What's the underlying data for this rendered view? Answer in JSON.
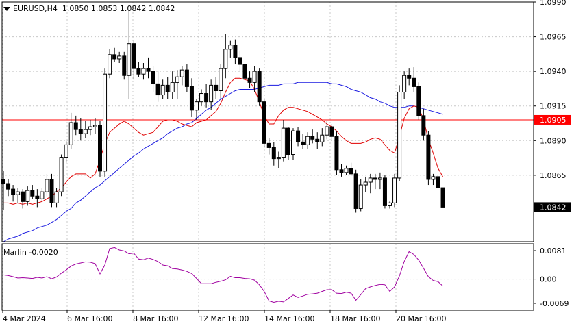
{
  "header": {
    "symbol": "EURUSD,H4",
    "ohlc": "1.0850 1.0853 1.0842 1.0842",
    "arrow_icon": "triangle-down-icon"
  },
  "indicator": {
    "label": "Marlin -0.0020",
    "ticks": [
      "0.0081",
      "0.00",
      "-0.0069"
    ]
  },
  "colors": {
    "ma_fast": "#e00000",
    "ma_slow": "#1a1ae0",
    "oscillator": "#a000a0",
    "level_line": "#ff0000",
    "level_box": "#ff0000",
    "price_box": "#000000",
    "grid": "#c8c8c8",
    "frame": "#000000"
  },
  "chart_data": {
    "type": "candlestick",
    "price_axis": {
      "ticks": [
        "1.0990",
        "1.0965",
        "1.0940",
        "1.0915",
        "1.0890",
        "1.0865",
        "1.0842"
      ],
      "range": [
        1.0817,
        1.099
      ]
    },
    "time_axis": {
      "labels": [
        "4 Mar 2024",
        "6 Mar 16:00",
        "8 Mar 16:00",
        "12 Mar 16:00",
        "14 Mar 16:00",
        "18 Mar 16:00",
        "20 Mar 16:00"
      ]
    },
    "horizontal_level": {
      "value": 1.0905,
      "label": "1.0905"
    },
    "current_price": {
      "value": 1.0842,
      "label": "1.0842"
    },
    "candles": [
      [
        1.0862,
        1.0868,
        1.084,
        1.0859
      ],
      [
        1.0859,
        1.0862,
        1.085,
        1.0855
      ],
      [
        1.0855,
        1.0858,
        1.0846,
        1.0851
      ],
      [
        1.0851,
        1.0856,
        1.0845,
        1.0853
      ],
      [
        1.0853,
        1.0855,
        1.0841,
        1.0846
      ],
      [
        1.0846,
        1.0857,
        1.0843,
        1.0854
      ],
      [
        1.0854,
        1.0858,
        1.0848,
        1.085
      ],
      [
        1.085,
        1.0855,
        1.0842,
        1.0848
      ],
      [
        1.0848,
        1.0856,
        1.0846,
        1.0853
      ],
      [
        1.0853,
        1.0866,
        1.085,
        1.0862
      ],
      [
        1.0862,
        1.0866,
        1.0842,
        1.0845
      ],
      [
        1.0845,
        1.0856,
        1.0842,
        1.0853
      ],
      [
        1.0853,
        1.088,
        1.085,
        1.0878
      ],
      [
        1.0878,
        1.089,
        1.0874,
        1.0887
      ],
      [
        1.0887,
        1.091,
        1.0884,
        1.0903
      ],
      [
        1.0903,
        1.0908,
        1.0894,
        1.0898
      ],
      [
        1.0898,
        1.0906,
        1.089,
        1.0895
      ],
      [
        1.0895,
        1.0904,
        1.0892,
        1.0898
      ],
      [
        1.0898,
        1.0905,
        1.0894,
        1.09
      ],
      [
        1.09,
        1.0906,
        1.0895,
        1.0901
      ],
      [
        1.0901,
        1.0904,
        1.0864,
        1.0868
      ],
      [
        1.0868,
        1.0942,
        1.0864,
        1.0938
      ],
      [
        1.0938,
        1.0956,
        1.0935,
        1.0952
      ],
      [
        1.0952,
        1.0957,
        1.0947,
        1.0949
      ],
      [
        1.0949,
        1.0954,
        1.0946,
        1.0951
      ],
      [
        1.0951,
        1.0954,
        1.0934,
        1.0937
      ],
      [
        1.0937,
        1.0984,
        1.092,
        1.096
      ],
      [
        1.096,
        1.0962,
        1.0934,
        1.0942
      ],
      [
        1.0942,
        1.0947,
        1.0936,
        1.0938
      ],
      [
        1.0938,
        1.0946,
        1.0934,
        1.0942
      ],
      [
        1.0942,
        1.095,
        1.0935,
        1.094
      ],
      [
        1.094,
        1.0944,
        1.0925,
        1.0931
      ],
      [
        1.0931,
        1.094,
        1.0918,
        1.0923
      ],
      [
        1.0923,
        1.0934,
        1.092,
        1.093
      ],
      [
        1.093,
        1.0936,
        1.092,
        1.0925
      ],
      [
        1.0925,
        1.094,
        1.092,
        1.0932
      ],
      [
        1.0932,
        1.0941,
        1.092,
        1.0936
      ],
      [
        1.0936,
        1.0944,
        1.093,
        1.0941
      ],
      [
        1.0941,
        1.0945,
        1.0925,
        1.0929
      ],
      [
        1.0929,
        1.0935,
        1.0907,
        1.0912
      ],
      [
        1.0912,
        1.092,
        1.0905,
        1.0918
      ],
      [
        1.0918,
        1.0927,
        1.0915,
        1.0924
      ],
      [
        1.0924,
        1.0931,
        1.0914,
        1.0918
      ],
      [
        1.0918,
        1.0934,
        1.0912,
        1.093
      ],
      [
        1.093,
        1.0936,
        1.092,
        1.0926
      ],
      [
        1.0926,
        1.0945,
        1.092,
        1.0942
      ],
      [
        1.0942,
        1.0967,
        1.0935,
        1.0956
      ],
      [
        1.0956,
        1.0962,
        1.095,
        1.0959
      ],
      [
        1.0959,
        1.0963,
        1.0945,
        1.095
      ],
      [
        1.095,
        1.0955,
        1.094,
        1.0945
      ],
      [
        1.0945,
        1.095,
        1.0932,
        1.0935
      ],
      [
        1.0935,
        1.094,
        1.0928,
        1.0932
      ],
      [
        1.0932,
        1.0944,
        1.0925,
        1.094
      ],
      [
        1.094,
        1.0942,
        1.0915,
        1.0918
      ],
      [
        1.0918,
        1.092,
        1.0885,
        1.0888
      ],
      [
        1.0888,
        1.0892,
        1.088,
        1.0885
      ],
      [
        1.0885,
        1.0889,
        1.0872,
        1.0877
      ],
      [
        1.0877,
        1.0882,
        1.087,
        1.0878
      ],
      [
        1.0878,
        1.0905,
        1.0875,
        1.0899
      ],
      [
        1.0899,
        1.09,
        1.0876,
        1.088
      ],
      [
        1.088,
        1.0899,
        1.0876,
        1.0897
      ],
      [
        1.0897,
        1.09,
        1.0886,
        1.0889
      ],
      [
        1.0889,
        1.0895,
        1.0884,
        1.0887
      ],
      [
        1.0887,
        1.0896,
        1.0884,
        1.0893
      ],
      [
        1.0893,
        1.0898,
        1.0888,
        1.0891
      ],
      [
        1.0891,
        1.0896,
        1.0884,
        1.0889
      ],
      [
        1.0889,
        1.0899,
        1.0886,
        1.0894
      ],
      [
        1.0894,
        1.0904,
        1.0891,
        1.09
      ],
      [
        1.09,
        1.0902,
        1.089,
        1.0893
      ],
      [
        1.0893,
        1.0897,
        1.0865,
        1.0869
      ],
      [
        1.0869,
        1.0873,
        1.0864,
        1.0867
      ],
      [
        1.0867,
        1.0872,
        1.0865,
        1.087
      ],
      [
        1.087,
        1.0874,
        1.0865,
        1.0866
      ],
      [
        1.0866,
        1.0869,
        1.0838,
        1.0841
      ],
      [
        1.0841,
        1.0862,
        1.0839,
        1.0858
      ],
      [
        1.0858,
        1.0864,
        1.0853,
        1.086
      ],
      [
        1.086,
        1.0866,
        1.0852,
        1.0863
      ],
      [
        1.0863,
        1.0866,
        1.0855,
        1.0862
      ],
      [
        1.0862,
        1.0867,
        1.0855,
        1.0863
      ],
      [
        1.0863,
        1.0865,
        1.0841,
        1.0843
      ],
      [
        1.0843,
        1.0846,
        1.0841,
        1.0845
      ],
      [
        1.0845,
        1.0866,
        1.0842,
        1.0863
      ],
      [
        1.0863,
        1.093,
        1.0861,
        1.0925
      ],
      [
        1.0925,
        1.094,
        1.092,
        1.0937
      ],
      [
        1.0937,
        1.0942,
        1.093,
        1.0935
      ],
      [
        1.0935,
        1.0943,
        1.0925,
        1.0929
      ],
      [
        1.0929,
        1.0932,
        1.0905,
        1.0908
      ],
      [
        1.0908,
        1.0913,
        1.089,
        1.0894
      ],
      [
        1.0894,
        1.0897,
        1.0858,
        1.0862
      ],
      [
        1.0862,
        1.0866,
        1.0858,
        1.0864
      ],
      [
        1.0864,
        1.0867,
        1.0855,
        1.0856
      ],
      [
        1.0856,
        1.0853,
        1.0842,
        1.0842
      ]
    ],
    "ma_fast": [
      1.0845,
      1.0845,
      1.0844,
      1.0845,
      1.0844,
      1.0845,
      1.0844,
      1.0845,
      1.0846,
      1.0848,
      1.085,
      1.0853,
      1.0856,
      1.086,
      1.0864,
      1.0866,
      1.0866,
      1.0866,
      1.0863,
      1.0866,
      1.0876,
      1.0888,
      1.0896,
      1.0899,
      1.0902,
      1.0904,
      1.0902,
      1.0899,
      1.0896,
      1.0894,
      1.0895,
      1.0896,
      1.09,
      1.0904,
      1.0905,
      1.0905,
      1.0904,
      1.0902,
      1.0901,
      1.09,
      1.0903,
      1.0904,
      1.0905,
      1.0908,
      1.0911,
      1.0917,
      1.0925,
      1.0932,
      1.0935,
      1.0935,
      1.0934,
      1.0933,
      1.0927,
      1.0918,
      1.0908,
      1.0902,
      1.0902,
      1.0908,
      1.0912,
      1.0914,
      1.0914,
      1.0913,
      1.0912,
      1.0911,
      1.0909,
      1.0907,
      1.0905,
      1.0902,
      1.09,
      1.0897,
      1.0893,
      1.089,
      1.0888,
      1.0888,
      1.0888,
      1.0889,
      1.0891,
      1.0892,
      1.0891,
      1.0887,
      1.0883,
      1.0881,
      1.0893,
      1.0906,
      1.0913,
      1.0915,
      1.0914,
      1.0905,
      1.0891,
      1.0881,
      1.087,
      1.0864
    ],
    "ma_slow": [
      1.0817,
      1.0819,
      1.082,
      1.0821,
      1.0823,
      1.0824,
      1.0825,
      1.0827,
      1.0828,
      1.0829,
      1.0831,
      1.0833,
      1.0836,
      1.0839,
      1.0841,
      1.0845,
      1.0847,
      1.085,
      1.0853,
      1.0856,
      1.0858,
      1.0861,
      1.0864,
      1.0867,
      1.087,
      1.0873,
      1.0876,
      1.0879,
      1.0881,
      1.0884,
      1.0886,
      1.0888,
      1.089,
      1.0892,
      1.0895,
      1.0897,
      1.0899,
      1.09,
      1.0902,
      1.0903,
      1.0906,
      1.0909,
      1.0912,
      1.0914,
      1.0917,
      1.092,
      1.0922,
      1.0924,
      1.0926,
      1.0927,
      1.0927,
      1.0927,
      1.0927,
      1.0928,
      1.0929,
      1.093,
      1.093,
      1.093,
      1.0931,
      1.0931,
      1.0931,
      1.0932,
      1.0932,
      1.0932,
      1.0932,
      1.0932,
      1.0932,
      1.0932,
      1.0931,
      1.0931,
      1.093,
      1.0929,
      1.0927,
      1.0926,
      1.0925,
      1.0923,
      1.0921,
      1.092,
      1.0918,
      1.0917,
      1.0915,
      1.0914,
      1.0914,
      1.0914,
      1.0915,
      1.0915,
      1.0914,
      1.0913,
      1.0912,
      1.0911,
      1.091,
      1.0909
    ],
    "oscillator": [
      0.0012,
      0.001,
      0.0007,
      0.0003,
      0.0004,
      0.0003,
      0.0002,
      0.0005,
      0.0003,
      0.0007,
      0.0001,
      0.0006,
      0.0017,
      0.0026,
      0.0037,
      0.0043,
      0.0046,
      0.0049,
      0.0048,
      0.0044,
      0.0015,
      0.004,
      0.0087,
      0.009,
      0.0083,
      0.008,
      0.0072,
      0.0074,
      0.0057,
      0.0055,
      0.006,
      0.0056,
      0.005,
      0.004,
      0.0038,
      0.003,
      0.0029,
      0.0026,
      0.0022,
      0.0016,
      0.0002,
      -0.0013,
      -0.0013,
      -0.0013,
      -0.0009,
      -0.0006,
      -0.0002,
      0.0008,
      0.0004,
      0.0004,
      0.0002,
      0.0001,
      -0.0003,
      -0.0016,
      -0.0035,
      -0.0062,
      -0.0066,
      -0.0063,
      -0.0065,
      -0.0055,
      -0.0045,
      -0.0052,
      -0.0048,
      -0.0043,
      -0.0042,
      -0.004,
      -0.0035,
      -0.003,
      -0.003,
      -0.004,
      -0.0041,
      -0.0037,
      -0.004,
      -0.006,
      -0.0044,
      -0.0027,
      -0.0022,
      -0.0018,
      -0.0015,
      -0.0016,
      -0.0035,
      -0.0022,
      0.0009,
      0.005,
      0.0078,
      0.007,
      0.0054,
      0.0031,
      0.0007,
      -0.0004,
      -0.0007,
      -0.002
    ],
    "oscillator_range": [
      -0.0069,
      0.0081
    ]
  }
}
